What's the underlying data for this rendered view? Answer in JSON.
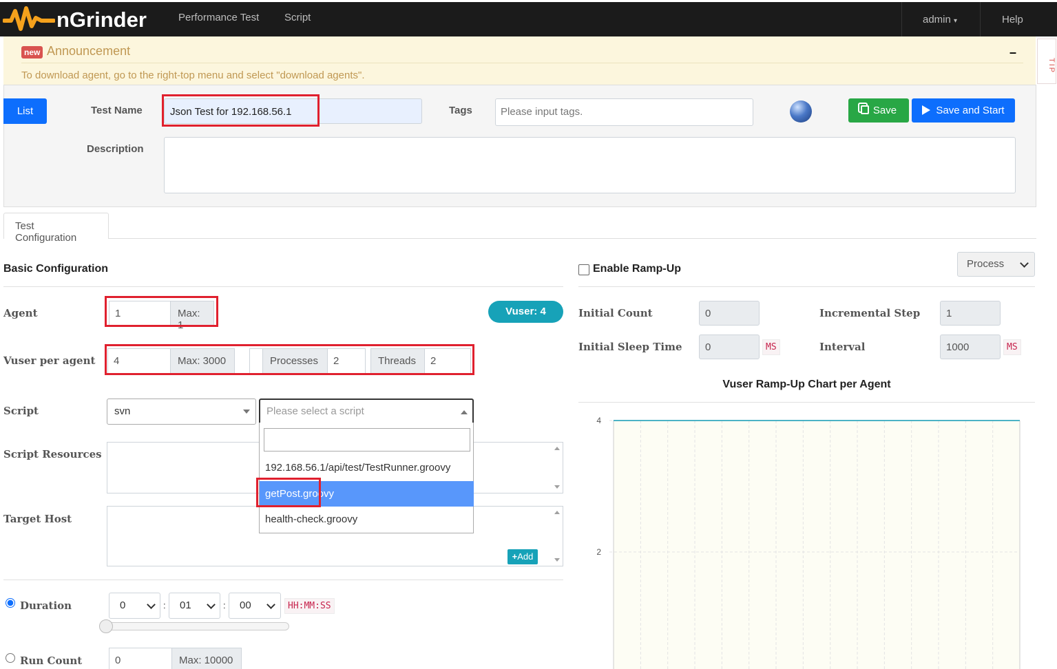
{
  "nav": {
    "brand": "nGrinder",
    "links": [
      "Performance Test",
      "Script"
    ],
    "user_menu": "admin",
    "help": "Help"
  },
  "announcement": {
    "badge": "new",
    "title": "Announcement",
    "text": "To download agent, go to the right-top menu and select \"download agents\".",
    "collapse": "–",
    "tip": "TIP"
  },
  "test": {
    "list_label": "List",
    "name_label": "Test Name",
    "name_value": "Json Test for 192.168.56.1",
    "tags_label": "Tags",
    "tags_placeholder": "Please input tags.",
    "save_label": "Save",
    "save_start_label": "Save and Start",
    "description_label": "Description"
  },
  "tabs": [
    "Test Configuration"
  ],
  "basic": {
    "title": "Basic Configuration",
    "agent_label": "Agent",
    "agent_value": "1",
    "agent_max": "Max: 1",
    "vuser_badge": "Vuser: 4",
    "vuser_label": "Vuser per agent",
    "vuser_value": "4",
    "vuser_max": "Max: 3000",
    "processes_label": "Processes",
    "processes_value": "2",
    "threads_label": "Threads",
    "threads_value": "2",
    "script_label": "Script",
    "repo_value": "svn",
    "script_placeholder": "Please select a script",
    "script_options": [
      "192.168.56.1/api/test/TestRunner.groovy",
      "getPost.groovy",
      "health-check.groovy"
    ],
    "resources_label": "Script Resources",
    "target_label": "Target Host",
    "add_label": "Add",
    "duration_label": "Duration",
    "duration_h": "0",
    "duration_m": "01",
    "duration_s": "00",
    "duration_hint": "HH:MM:SS",
    "runcount_label": "Run Count",
    "runcount_value": "0",
    "runcount_max": "Max: 10000"
  },
  "rampup": {
    "enable_label": "Enable Ramp-Up",
    "mode": "Process",
    "initial_count_label": "Initial Count",
    "initial_count": "0",
    "incremental_step_label": "Incremental Step",
    "incremental_step": "1",
    "initial_sleep_label": "Initial Sleep Time",
    "initial_sleep": "0",
    "ms": "MS",
    "interval_label": "Interval",
    "interval": "1000"
  },
  "chart_data": {
    "type": "line",
    "title": "Vuser Ramp-Up Chart per Agent",
    "yticks": [
      2,
      4
    ],
    "ylim": [
      0,
      4
    ],
    "series": [
      {
        "values": [
          4,
          4
        ]
      }
    ],
    "grid": true
  }
}
